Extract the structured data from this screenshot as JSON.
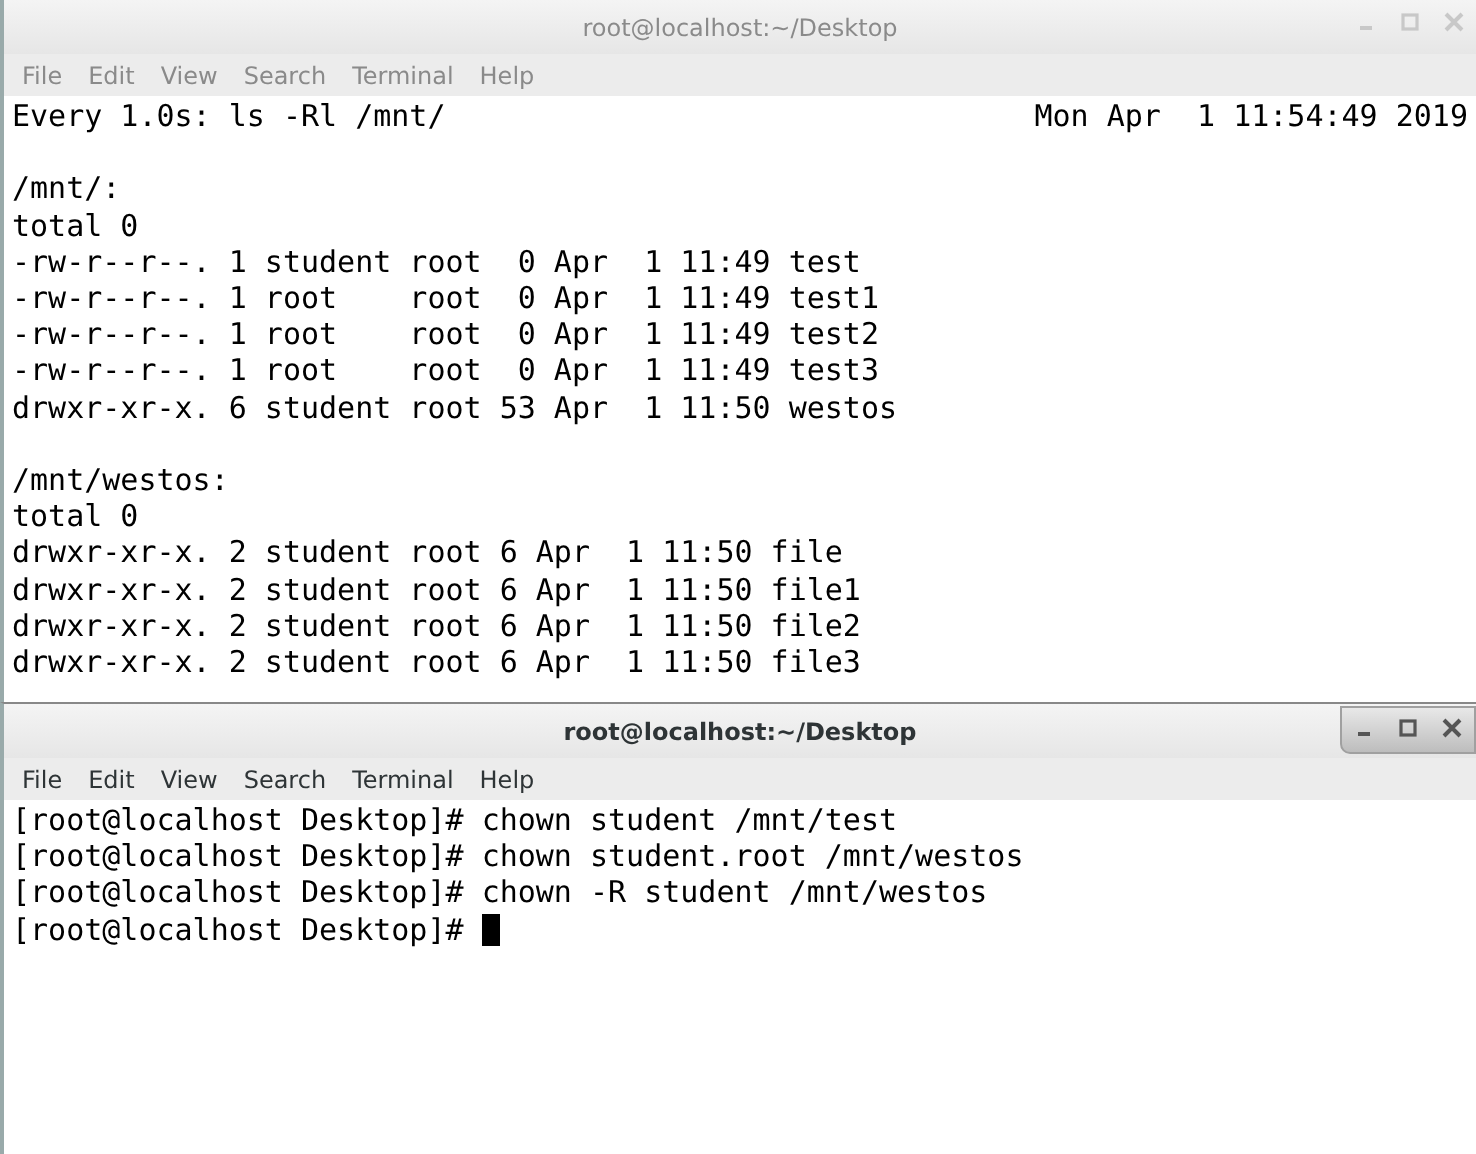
{
  "windows": [
    {
      "title": "root@localhost:~/Desktop",
      "active": false,
      "menu": [
        "File",
        "Edit",
        "View",
        "Search",
        "Terminal",
        "Help"
      ],
      "kind": "watch",
      "watch": {
        "command": "Every 1.0s: ls -Rl /mnt/",
        "timestamp": "Mon Apr  1 11:54:49 2019",
        "listings": [
          {
            "heading": "/mnt/:",
            "total": "total 0",
            "entries": [
              "-rw-r--r--. 1 student root  0 Apr  1 11:49 test",
              "-rw-r--r--. 1 root    root  0 Apr  1 11:49 test1",
              "-rw-r--r--. 1 root    root  0 Apr  1 11:49 test2",
              "-rw-r--r--. 1 root    root  0 Apr  1 11:49 test3",
              "drwxr-xr-x. 6 student root 53 Apr  1 11:50 westos"
            ]
          },
          {
            "heading": "/mnt/westos:",
            "total": "total 0",
            "entries": [
              "drwxr-xr-x. 2 student root 6 Apr  1 11:50 file",
              "drwxr-xr-x. 2 student root 6 Apr  1 11:50 file1",
              "drwxr-xr-x. 2 student root 6 Apr  1 11:50 file2",
              "drwxr-xr-x. 2 student root 6 Apr  1 11:50 file3"
            ]
          }
        ]
      }
    },
    {
      "title": "root@localhost:~/Desktop",
      "active": true,
      "menu": [
        "File",
        "Edit",
        "View",
        "Search",
        "Terminal",
        "Help"
      ],
      "kind": "shell",
      "shell": {
        "history": [
          {
            "prompt": "[root@localhost Desktop]#",
            "command": "chown student /mnt/test"
          },
          {
            "prompt": "[root@localhost Desktop]#",
            "command": "chown student.root /mnt/westos"
          },
          {
            "prompt": "[root@localhost Desktop]#",
            "command": "chown -R student /mnt/westos"
          }
        ],
        "prompt": "[root@localhost Desktop]#"
      }
    }
  ]
}
